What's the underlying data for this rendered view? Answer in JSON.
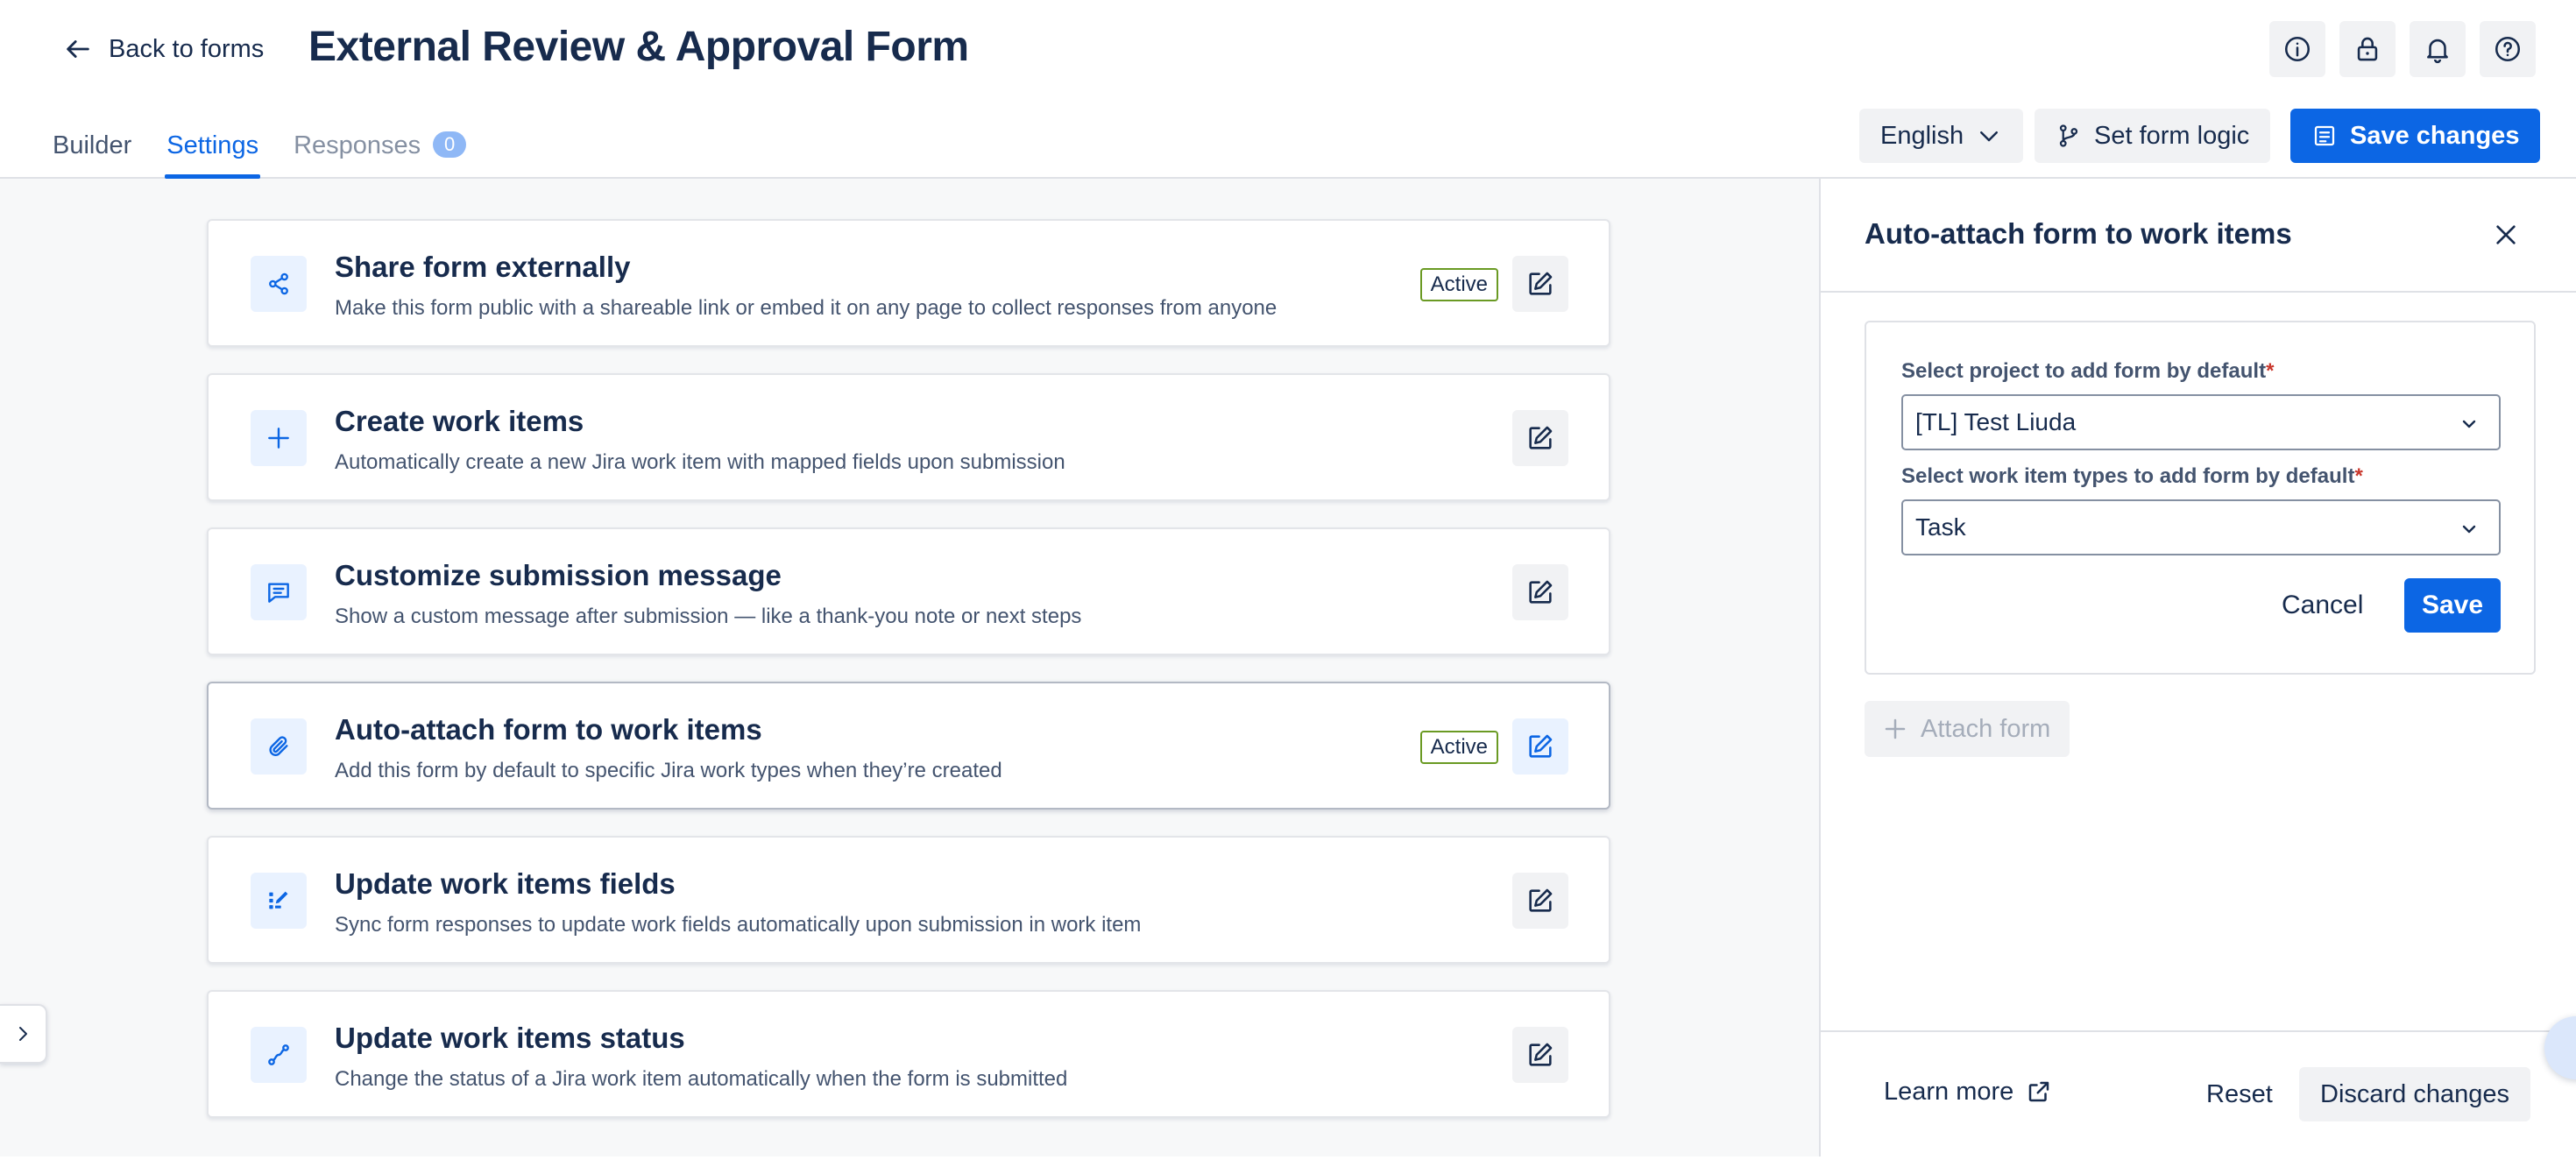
{
  "header": {
    "back_label": "Back to forms",
    "title": "External Review & Approval Form",
    "icons": [
      "info-icon",
      "lock-icon",
      "bell-icon",
      "help-icon"
    ],
    "tabs": [
      {
        "label": "Builder"
      },
      {
        "label": "Settings"
      },
      {
        "label": "Responses",
        "badge": "0"
      }
    ],
    "language": "English",
    "logic_label": "Set form logic",
    "save_label": "Save changes"
  },
  "cards": [
    {
      "title": "Share form externally",
      "desc": "Make this form public with a shareable link or embed it on any page to collect responses from anyone",
      "status": "Active",
      "icon": "share-icon"
    },
    {
      "title": "Create work items",
      "desc": "Automatically create a new Jira work item with mapped fields upon submission",
      "icon": "plus-icon"
    },
    {
      "title": "Customize submission message",
      "desc": "Show a custom message after submission — like a thank-you note or next steps",
      "icon": "message-icon"
    },
    {
      "title": "Auto-attach form to work items",
      "desc": "Add this form by default to specific Jira work types when they’re created",
      "status": "Active",
      "icon": "paperclip-icon"
    },
    {
      "title": "Update work items fields",
      "desc": "Sync form responses to update work fields automatically upon submission in work item",
      "icon": "fields-edit-icon"
    },
    {
      "title": "Update work items status",
      "desc": "Change the status of a Jira work item automatically when the form is submitted",
      "icon": "status-flow-icon"
    }
  ],
  "panel": {
    "title": "Auto-attach form to work items",
    "project_label": "Select project to add form by default",
    "project_value": "[TL] Test Liuda",
    "types_label": "Select work item types to add form by default",
    "types_value": "Task",
    "required_mark": "*",
    "cancel_label": "Cancel",
    "save_label": "Save",
    "attach_label": "Attach form",
    "learn_more_label": "Learn more",
    "reset_label": "Reset",
    "discard_label": "Discard changes"
  },
  "colors": {
    "accent": "#0c66e4",
    "active_border": "#6a9a23",
    "required": "#c9372c"
  }
}
